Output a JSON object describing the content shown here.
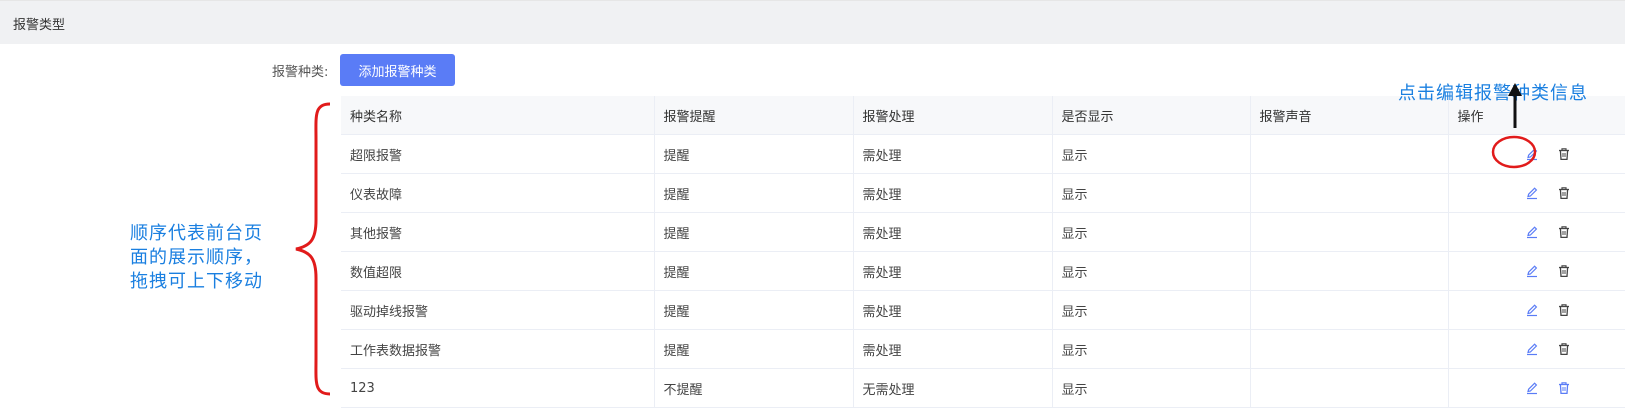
{
  "header": {
    "title": "报警类型"
  },
  "toolbar": {
    "kind_label": "报警种类:",
    "add_button": "添加报警种类"
  },
  "table": {
    "columns": [
      "种类名称",
      "报警提醒",
      "报警处理",
      "是否显示",
      "报警声音",
      "操作"
    ],
    "rows": [
      [
        "超限报警",
        "提醒",
        "需处理",
        "显示",
        ""
      ],
      [
        "仪表故障",
        "提醒",
        "需处理",
        "显示",
        ""
      ],
      [
        "其他报警",
        "提醒",
        "需处理",
        "显示",
        ""
      ],
      [
        "数值超限",
        "提醒",
        "需处理",
        "显示",
        ""
      ],
      [
        "驱动掉线报警",
        "提醒",
        "需处理",
        "显示",
        ""
      ],
      [
        "工作表数据报警",
        "提醒",
        "需处理",
        "显示",
        ""
      ],
      [
        "123",
        "不提醒",
        "无需处理",
        "显示",
        ""
      ]
    ]
  },
  "annotations": {
    "left_note_lines": [
      "顺序代表前台页",
      "面的展示顺序，",
      "拖拽可上下移动"
    ],
    "right_note": "点击编辑报警种类信息"
  },
  "colors": {
    "accent": "#5a7cf6",
    "annotation": "#1a7fe0",
    "highlight": "#e11b1b"
  },
  "icons": {
    "edit": "pencil-icon",
    "delete": "trash-icon"
  }
}
